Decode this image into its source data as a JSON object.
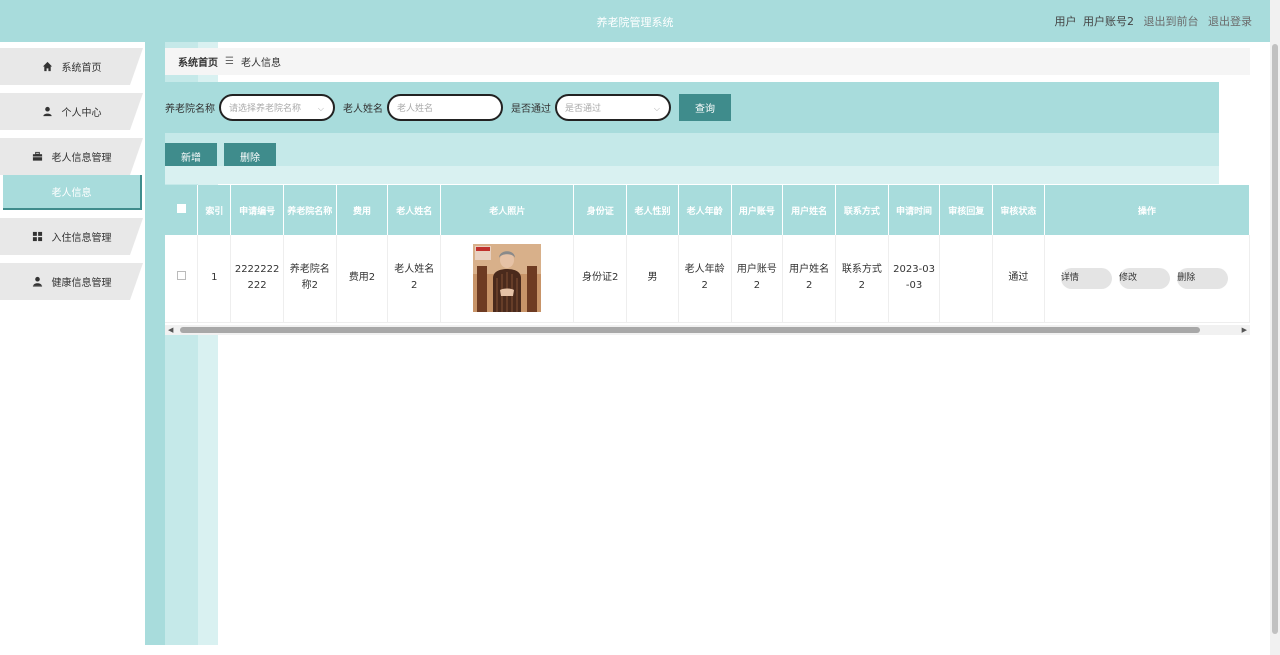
{
  "header": {
    "title": "养老院管理系统",
    "user_role": "用户",
    "user_account": "用户账号2",
    "back_to_front": "退出到前台",
    "logout": "退出登录"
  },
  "sidebar": {
    "items": [
      {
        "label": "系统首页",
        "icon": "home-icon"
      },
      {
        "label": "个人中心",
        "icon": "user-icon"
      },
      {
        "label": "老人信息管理",
        "icon": "briefcase-icon"
      },
      {
        "label": "老人信息",
        "icon": ""
      },
      {
        "label": "入住信息管理",
        "icon": "grid-icon"
      },
      {
        "label": "健康信息管理",
        "icon": "user-icon"
      }
    ]
  },
  "breadcrumb": {
    "home": "系统首页",
    "separator": "☰",
    "current": "老人信息"
  },
  "search": {
    "nursing_home_label": "养老院名称",
    "nursing_home_placeholder": "请选择养老院名称",
    "elder_name_label": "老人姓名",
    "elder_name_placeholder": "老人姓名",
    "approved_label": "是否通过",
    "approved_placeholder": "是否通过",
    "query_button": "查询"
  },
  "actions": {
    "add": "新增",
    "delete": "删除"
  },
  "table": {
    "headers": [
      "索引",
      "申请编号",
      "养老院名称",
      "费用",
      "老人姓名",
      "老人照片",
      "身份证",
      "老人性别",
      "老人年龄",
      "用户账号",
      "用户姓名",
      "联系方式",
      "申请时间",
      "审核回复",
      "审核状态",
      "操作"
    ],
    "rows": [
      {
        "index": "1",
        "apply_no": "2222222222",
        "nursing_home": "养老院名称2",
        "fee": "费用2",
        "elder_name": "老人姓名2",
        "id_card": "身份证2",
        "gender": "男",
        "age": "老人年龄2",
        "user_account": "用户账号2",
        "user_name": "用户姓名2",
        "contact": "联系方式2",
        "apply_time": "2023-03-03",
        "review_reply": "",
        "review_status": "通过",
        "op_detail": "详情",
        "op_edit": "修改",
        "op_delete": "删除"
      }
    ]
  },
  "colors": {
    "primary": "#a8dcdc",
    "dark": "#3f8c8c",
    "light": "#c5e9e9"
  }
}
